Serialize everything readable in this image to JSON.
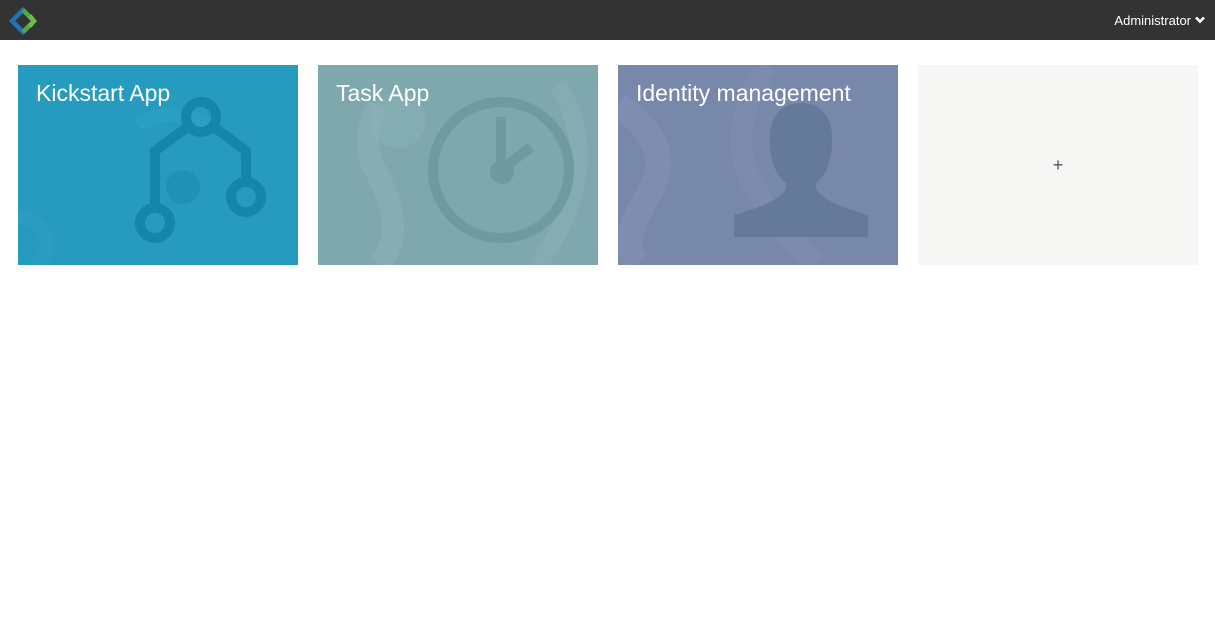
{
  "topbar": {
    "background": "#333333",
    "logo_icon": "diamond-logo-icon",
    "user_menu": {
      "label": "Administrator",
      "icon": "chevron-down-icon"
    }
  },
  "apps": [
    {
      "title": "Kickstart App",
      "color": "#269bbf",
      "icon": "process-branch-icon"
    },
    {
      "title": "Task App",
      "color": "#7fa8ad",
      "icon": "clock-icon"
    },
    {
      "title": "Identity management",
      "color": "#7888ab",
      "icon": "user-silhouette-icon"
    }
  ],
  "add_tile": {
    "label": "+",
    "color": "#f6f6f4"
  }
}
